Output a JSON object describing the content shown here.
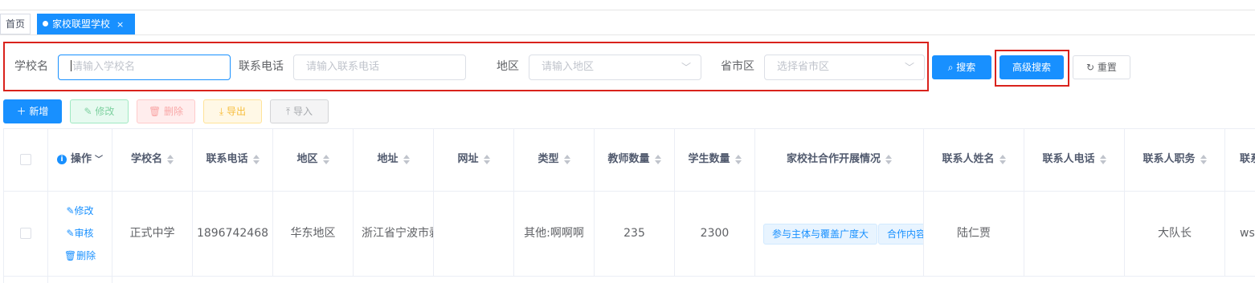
{
  "tabs": {
    "home_label": "首页",
    "active_label": "家校联盟学校",
    "close_symbol": "×"
  },
  "search": {
    "school_label": "学校名",
    "school_placeholder": "请输入学校名",
    "phone_label": "联系电话",
    "phone_placeholder": "请输入联系电话",
    "region_label": "地区",
    "region_placeholder": "请输入地区",
    "province_label": "省市区",
    "province_placeholder": "选择省市区",
    "search_button": "搜索",
    "advanced_button": "高级搜索",
    "reset_button": "重置"
  },
  "toolbar": {
    "new_label": "新增",
    "edit_label": "修改",
    "delete_label": "删除",
    "export_label": "导出",
    "import_label": "导入"
  },
  "table": {
    "headers": {
      "ops": "操作",
      "school": "学校名",
      "phone": "联系电话",
      "region": "地区",
      "address": "地址",
      "website": "网址",
      "type": "类型",
      "teachers": "教师数量",
      "students": "学生数量",
      "cooperation": "家校社合作开展情况",
      "contact_name": "联系人姓名",
      "contact_phone": "联系人电话",
      "contact_title": "联系人职务",
      "last_partial": "联系"
    },
    "row": {
      "op_edit": "修改",
      "op_review": "审核",
      "op_delete": "删除",
      "school": "正式中学",
      "phone": "1896742468",
      "region": "华东地区",
      "address": "浙江省宁波市剥",
      "website": "",
      "type": "其他:啊啊啊",
      "teachers": "235",
      "students": "2300",
      "tag1": "参与主体与覆盖广度大",
      "tag2": "合作内容",
      "contact_name": "陆仁贾",
      "contact_phone": "",
      "contact_title": "大队长",
      "last_partial": "wss"
    }
  },
  "colors": {
    "primary": "#1890ff",
    "highlight_border": "#d9221c"
  }
}
